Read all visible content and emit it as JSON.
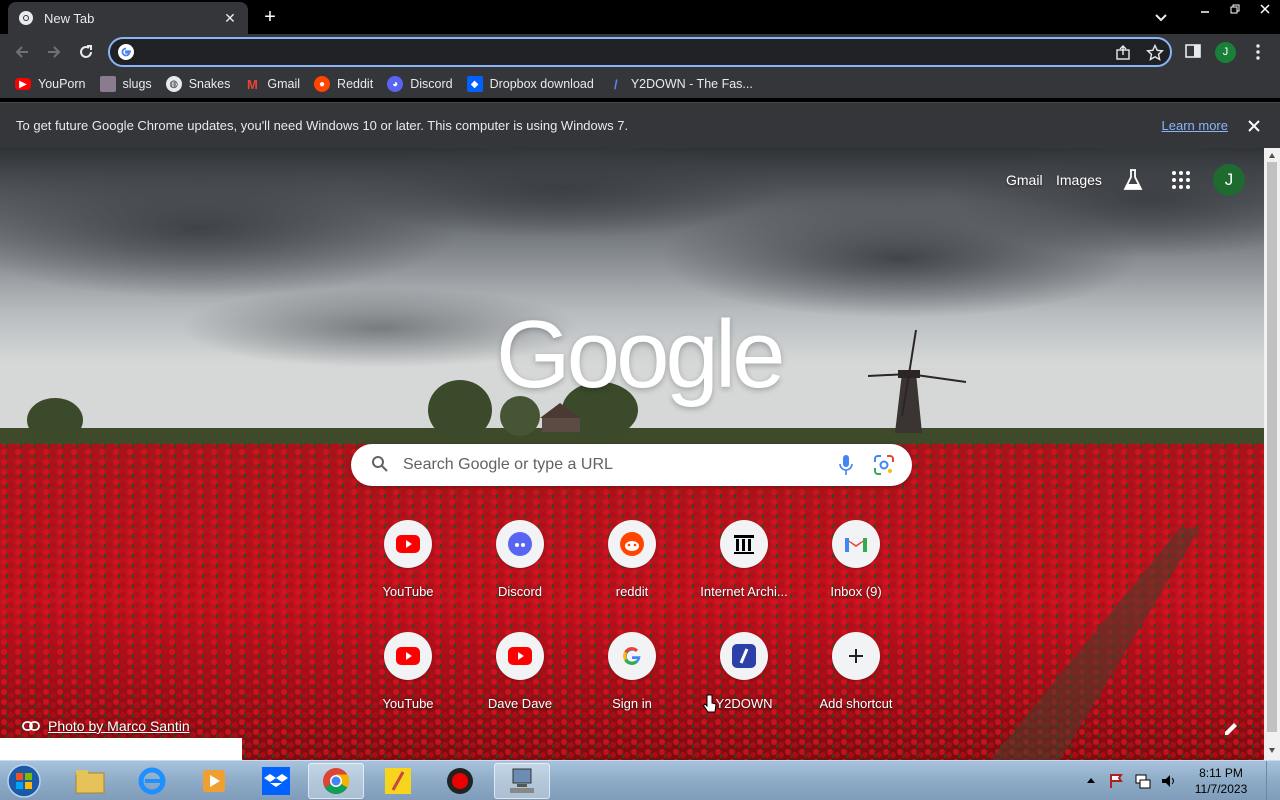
{
  "tab": {
    "title": "New Tab"
  },
  "omnibox": {
    "value": "",
    "placeholder": ""
  },
  "bookmarks": [
    {
      "label": "YouPorn",
      "icon": "youtube-like-icon",
      "color": "#ff0000"
    },
    {
      "label": "slugs",
      "icon": "image-icon",
      "color": "#8a7b8f"
    },
    {
      "label": "Snakes",
      "icon": "globe-icon",
      "color": "#e8eaed"
    },
    {
      "label": "Gmail",
      "icon": "gmail-icon",
      "color": "#ea4335"
    },
    {
      "label": "Reddit",
      "icon": "reddit-icon",
      "color": "#ff4500"
    },
    {
      "label": "Discord",
      "icon": "discord-icon",
      "color": "#5865f2"
    },
    {
      "label": "Dropbox download",
      "icon": "dropbox-icon",
      "color": "#0061ff"
    },
    {
      "label": "Y2DOWN - The Fas...",
      "icon": "y2down-icon",
      "color": "#2c3ea8"
    }
  ],
  "infobar": {
    "message": "To get future Google Chrome updates, you'll need Windows 10 or later. This computer is using Windows 7.",
    "link": "Learn more"
  },
  "ntp": {
    "gmail": "Gmail",
    "images": "Images",
    "avatar_letter": "J",
    "logo": "Google",
    "search_placeholder": "Search Google or type a URL",
    "attribution": "Photo by Marco Santin"
  },
  "shortcuts": [
    {
      "label": "YouTube",
      "icon": "youtube-icon"
    },
    {
      "label": "Discord",
      "icon": "discord-icon"
    },
    {
      "label": "reddit",
      "icon": "reddit-icon"
    },
    {
      "label": "Internet Archi...",
      "icon": "archive-icon"
    },
    {
      "label": "Inbox (9)",
      "icon": "gmail-icon"
    },
    {
      "label": "YouTube",
      "icon": "youtube-icon"
    },
    {
      "label": "Dave Dave",
      "icon": "youtube-icon"
    },
    {
      "label": "Sign in",
      "icon": "google-icon"
    },
    {
      "label": "Y2DOWN",
      "icon": "y2down-icon"
    },
    {
      "label": "Add shortcut",
      "icon": "plus-icon"
    }
  ],
  "taskbar": {
    "time": "8:11 PM",
    "date": "11/7/2023"
  },
  "colors": {
    "accent": "#8ab4f8",
    "toolbar": "#35363a",
    "avatar": "#188038"
  }
}
